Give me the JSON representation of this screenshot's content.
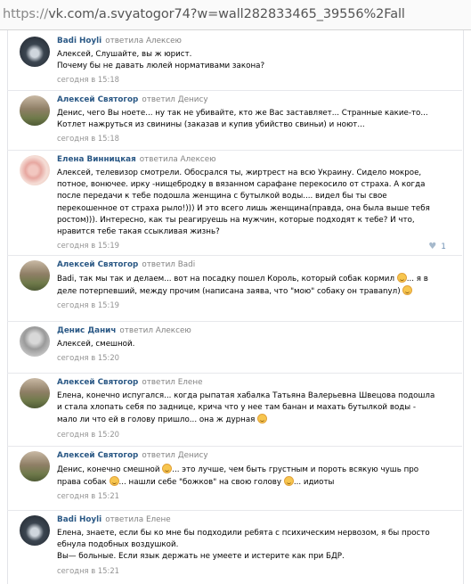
{
  "address_bar": {
    "scheme": "https://",
    "rest": "vk.com/a.svyatogor74?w=wall282833465_39556%2Fall"
  },
  "colors": {
    "author": "#2a5885",
    "meta": "#939393",
    "divider": "#e7e8ec"
  },
  "comments": [
    {
      "author": "Badi Hoyli",
      "replied": "ответила Алексею",
      "text": "Алексей, Слушайте, вы ж юрист.\nПочему бы не давать люлей нормативами закона?",
      "date": "сегодня в 15:18"
    },
    {
      "author": "Алексей Святогор",
      "replied": "ответил Денису",
      "text": "Денис, чего Вы ноете... ну так не убивайте, кто же Вас заставляет... Странные какие-то...\nКотлет нажруться из свинины (заказав и купив убийство свиньи) и ноют...",
      "date": "сегодня в 15:18"
    },
    {
      "author": "Елена Винницкая",
      "replied": "ответила Алексею",
      "text": "Алексей, телевизор смотрели. Обосрался ты, жиртрест на всю Украину. Сидело мокрое,\nпотное, вонючее. ирку -нищебродку в вязанном сарафане перекосило от страха. А когда\nпосле передачи к тебе подошла женщина с бутылкой воды.... видел бы ты свое\nперекошенное от страха рыло!))) И это всего лишь женщина(правда, она была выше тебя\nростом))). Интересно, как ты реагируешь на мужчин, которые подходят к тебе? И что,\nнравится тебе такая ссыкливая жизнь?",
      "date": "сегодня в 15:19",
      "likes": "1"
    },
    {
      "author": "Алексей Святогор",
      "replied": "ответил Badi",
      "text_1": "Badi, так мы так и делаем... вот на посадку пошел Король, который собак кормил ",
      "text_2": "... я в\nделе потерпевший, между прочим (написана заява, что \"мою\" собаку он травanул) ",
      "date": "сегодня в 15:19"
    },
    {
      "author": "Денис Данич",
      "replied": "ответил Алексею",
      "text": "Алексей, смешной.",
      "date": "сегодня в 15:20"
    },
    {
      "author": "Алексей Святогор",
      "replied": "ответил Елене",
      "text_1": "Елена, конечно испугался... когда рыпатая хабалка Татьяна Валерьевна Швецова подошла\nи стала хлопать себя по заднице, крича что у нее там банан и махать бутылкой воды -\nмало ли что ей в голову пришло... она ж дурная ",
      "date": "сегодня в 15:20"
    },
    {
      "author": "Алексей Святогор",
      "replied": "ответил Денису",
      "text_1": "Денис, конечно смешной ",
      "text_2": "... это лучше, чем быть грустным и пороть всякую чушь про\nправа собак ",
      "text_3": "... нашли себе \"божков\" на свою голову ",
      "text_4": "... идиоты",
      "date": "сегодня в 15:21"
    },
    {
      "author": "Badi Hoyli",
      "replied": "ответила Елене",
      "text": "Елена, знаете, если бы ко мне бы подходили ребята с психическим нервозом, я бы просто\nебнула подобных воздушкой.\nВы— больные. Если язык держать не умеете и истерите как при БДР.",
      "date": "сегодня в 15:21"
    }
  ]
}
